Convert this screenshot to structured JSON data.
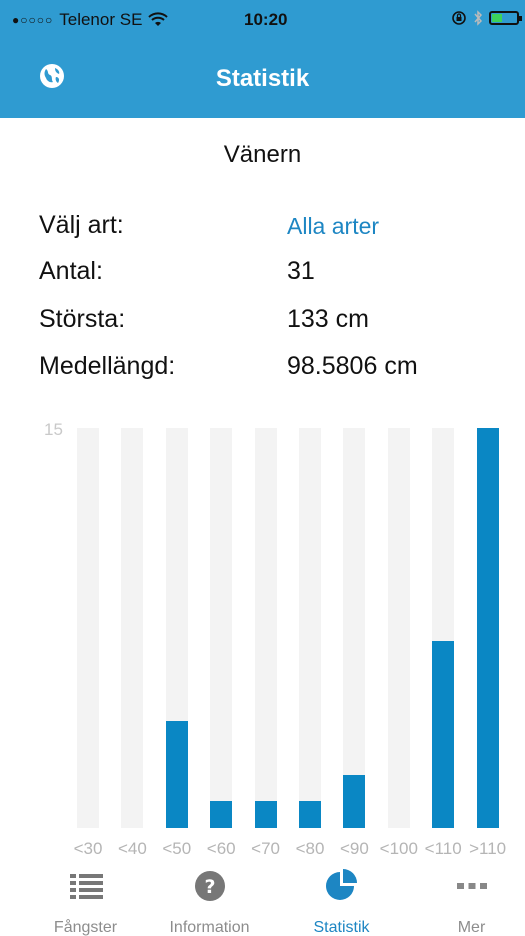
{
  "status_bar": {
    "signal": "●○○○○",
    "carrier": "Telenor SE",
    "time": "10:20",
    "icons": [
      "wifi-icon",
      "orientation-lock-icon",
      "bluetooth-icon",
      "battery-icon"
    ]
  },
  "nav": {
    "title": "Statistik",
    "left_icon": "globe-icon"
  },
  "location": "Vänern",
  "stats": {
    "species_label": "Välj art:",
    "species_value": "Alla arter",
    "count_label": "Antal:",
    "count_value": "31",
    "largest_label": "Största:",
    "largest_value": "133 cm",
    "mean_label": "Medellängd:",
    "mean_value": "98.5806 cm"
  },
  "chart_data": {
    "type": "bar",
    "categories": [
      "<30",
      "<40",
      "<50",
      "<60",
      "<70",
      "<80",
      "<90",
      "<100",
      "<110",
      ">110"
    ],
    "values": [
      0,
      0,
      4,
      1,
      1,
      1,
      2,
      0,
      7,
      15
    ],
    "ylim": [
      0,
      15
    ],
    "y_max_label": "15",
    "bar_color": "#0a87c4",
    "track_color": "#f3f3f3",
    "grid": false
  },
  "tabs": [
    {
      "label": "Fångster",
      "icon": "list-icon",
      "active": false
    },
    {
      "label": "Information",
      "icon": "help-icon",
      "active": false
    },
    {
      "label": "Statistik",
      "icon": "pie-chart-icon",
      "active": true
    },
    {
      "label": "Mer",
      "icon": "more-icon",
      "active": false
    }
  ],
  "colors": {
    "accent": "#2f9bd1",
    "link": "#1d86c3",
    "inactive": "#8d8d8d"
  }
}
